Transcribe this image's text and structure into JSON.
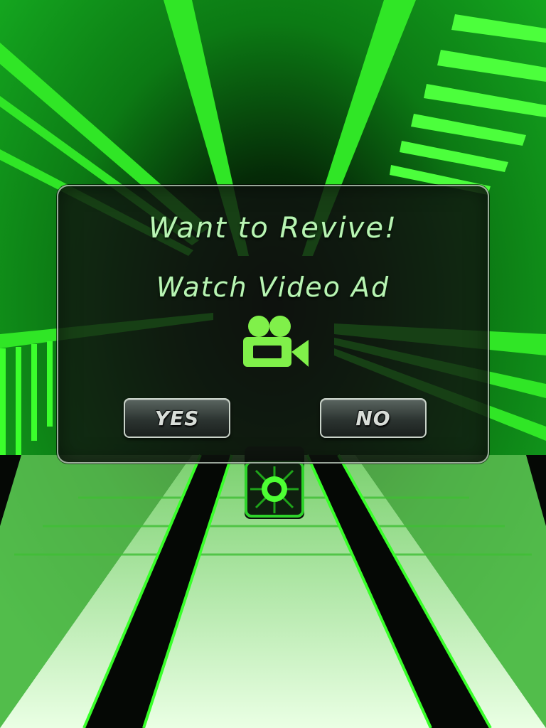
{
  "dialog": {
    "title": "Want to Revive!",
    "subtitle": "Watch Video Ad",
    "icon": "video-camera-icon",
    "yes_label": "YES",
    "no_label": "NO"
  },
  "player": {
    "icon": "target-ring-icon"
  },
  "colors": {
    "neon_green": "#38f02a",
    "dialog_text": "#b9f3b4",
    "icon_green": "#80f04a",
    "button_text": "#d8ddd8"
  }
}
